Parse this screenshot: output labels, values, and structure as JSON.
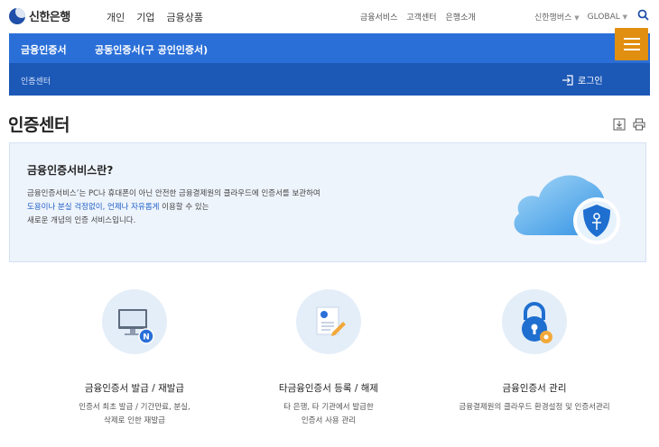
{
  "brand": {
    "name": "신한은행"
  },
  "main_nav": [
    "개인",
    "기업",
    "금융상품"
  ],
  "util_nav": [
    "금융서비스",
    "고객센터",
    "은행소개"
  ],
  "lang_nav": {
    "family": "신한행버스",
    "global": "GLOBAL"
  },
  "header": {
    "tabs": [
      "금융인증서",
      "공동인증서(구 공인인증서)"
    ],
    "breadcrumb": "인증센터",
    "login_label": "로그인"
  },
  "page": {
    "title": "인증센터"
  },
  "info": {
    "title": "금융인증서비스란?",
    "line1": "금융인증서비스’는 PC나 휴대폰이 아닌 안전한 금융결제원의 클라우드에 인증서를 보관하여",
    "line2_hl1": "도용이나 분실 걱정없이,",
    "line2_hl2": "언제나 자유롭게",
    "line2_rest": "이용할 수 있는",
    "line3": "새로운 개념의 인증 서비스입니다."
  },
  "features": [
    {
      "icon": "computer-icon",
      "title": "금융인증서 발급 / 재발급",
      "desc": "인증서 최초 발급 / 기간만료, 분실,\n삭제로 인한 재발급"
    },
    {
      "icon": "certificate-edit-icon",
      "title": "타금융인증서 등록 / 해제",
      "desc": "타 은행, 타 기관에서 발급한\n인증서 사용 관리"
    },
    {
      "icon": "lock-gear-icon",
      "title": "금융인증서 관리",
      "desc": "금융결제원의 클라우드 환경설정 및 인증서관리"
    }
  ],
  "colors": {
    "primary": "#2a6fd8",
    "primary_dark": "#1c58b6",
    "menu": "#e08f10",
    "infobox": "#eef4fc"
  }
}
